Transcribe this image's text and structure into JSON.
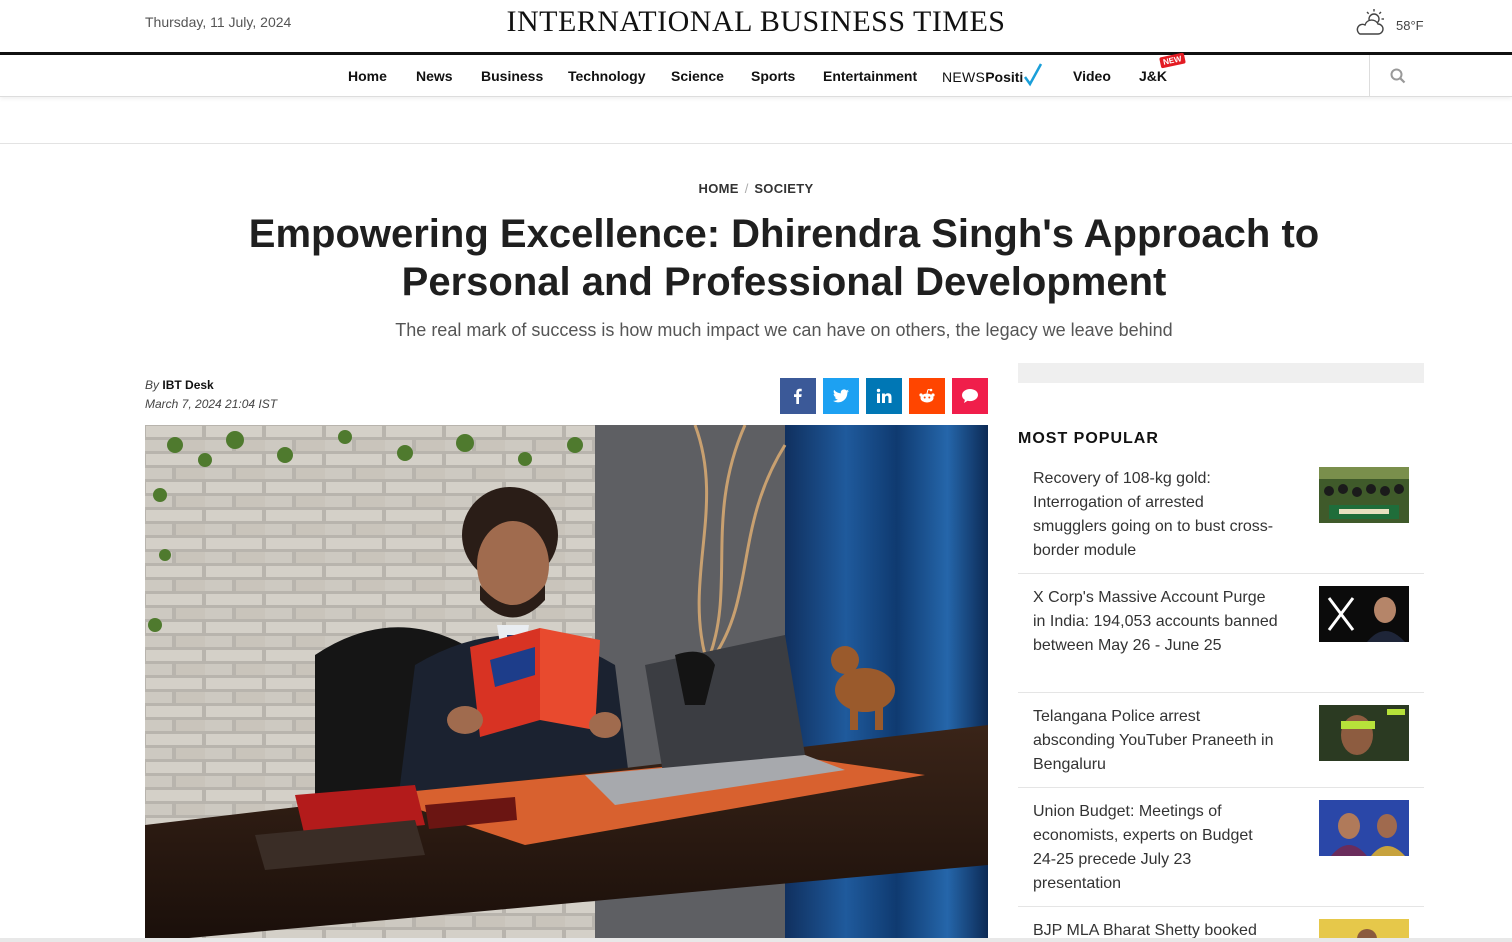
{
  "header": {
    "date": "Thursday, 11 July, 2024",
    "logo": "INTERNATIONAL BUSINESS TIMES",
    "weather": {
      "icon": "cloud-sun-icon",
      "temp": "58°F"
    }
  },
  "nav": {
    "items": [
      "Home",
      "News",
      "Business",
      "Technology",
      "Science",
      "Sports",
      "Entertainment"
    ],
    "newspositive": {
      "part1": "NEWS",
      "part2": "Positi"
    },
    "video": "Video",
    "jk": "J&K",
    "new_badge": "NEW",
    "search_icon": "search-icon"
  },
  "breadcrumb": {
    "home": "HOME",
    "section": "SOCIETY"
  },
  "article": {
    "title": "Empowering Excellence: Dhirendra Singh's Approach to Personal and Professional Development",
    "subtitle": "The real mark of success is how much impact we can have on others, the legacy we leave behind",
    "by": "By",
    "author": "IBT Desk",
    "date": "March 7, 2024 21:04 IST",
    "share": [
      {
        "name": "facebook",
        "color": "#3b5998"
      },
      {
        "name": "twitter",
        "color": "#1da1f2"
      },
      {
        "name": "linkedin",
        "color": "#0077b5"
      },
      {
        "name": "reddit",
        "color": "#ff4500"
      },
      {
        "name": "comment",
        "color": "#f01e4b"
      }
    ]
  },
  "sidebar": {
    "heading": "MOST POPULAR",
    "items": [
      {
        "title": "Recovery of 108-kg gold: Interrogation of arrested smugglers going on to bust cross-border module"
      },
      {
        "title": "X Corp's Massive Account Purge in India: 194,053 accounts banned between May 26 - June 25"
      },
      {
        "title": "Telangana Police arrest absconding YouTuber Praneeth in Bengaluru"
      },
      {
        "title": "Union Budget: Meetings of economists, experts on Budget 24-25 precede July 23 presentation"
      },
      {
        "title": "BJP MLA Bharat Shetty booked"
      }
    ]
  }
}
